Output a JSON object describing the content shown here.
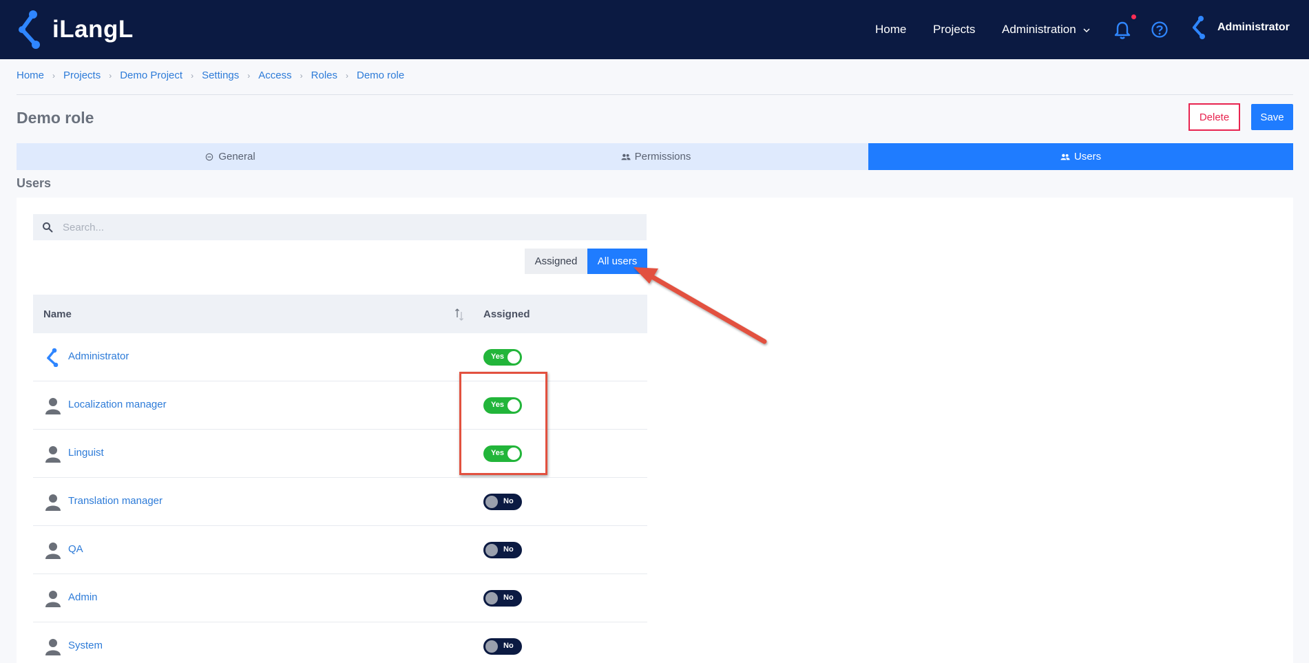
{
  "app": {
    "logo_text": "iLangL",
    "brand_colors": {
      "navbar": "#0b1a42",
      "accent": "#1f7cff",
      "danger": "#e8234f",
      "success": "#22b53a"
    }
  },
  "nav": {
    "home": "Home",
    "projects": "Projects",
    "administration": "Administration",
    "user_name": "Administrator",
    "icons": [
      "bell-icon",
      "help-icon",
      "user-logo-icon",
      "chevron-down-icon"
    ]
  },
  "breadcrumb": [
    "Home",
    "Projects",
    "Demo Project",
    "Settings",
    "Access",
    "Roles",
    "Demo role"
  ],
  "page": {
    "title": "Demo role",
    "delete_label": "Delete",
    "save_label": "Save",
    "section_title": "Users"
  },
  "tabs": [
    {
      "label": "General",
      "icon": "minus-circle-icon",
      "active": false
    },
    {
      "label": "Permissions",
      "icon": "users-icon",
      "active": false
    },
    {
      "label": "Users",
      "icon": "users-icon",
      "active": true
    }
  ],
  "search": {
    "placeholder": "Search...",
    "value": ""
  },
  "filter": {
    "assigned_label": "Assigned",
    "all_label": "All users",
    "selected": "All users"
  },
  "table": {
    "columns": [
      "Name",
      "Assigned"
    ],
    "rows": [
      {
        "name": "Administrator",
        "avatar": "logo-avatar",
        "assigned": true,
        "toggle_label": "Yes"
      },
      {
        "name": "Localization manager",
        "avatar": "person-avatar",
        "assigned": true,
        "toggle_label": "Yes"
      },
      {
        "name": "Linguist",
        "avatar": "person-avatar",
        "assigned": true,
        "toggle_label": "Yes"
      },
      {
        "name": "Translation manager",
        "avatar": "person-avatar",
        "assigned": false,
        "toggle_label": "No"
      },
      {
        "name": "QA",
        "avatar": "person-avatar",
        "assigned": false,
        "toggle_label": "No"
      },
      {
        "name": "Admin",
        "avatar": "person-avatar",
        "assigned": false,
        "toggle_label": "No"
      },
      {
        "name": "System",
        "avatar": "person-avatar",
        "assigned": false,
        "toggle_label": "No"
      }
    ]
  },
  "annotations": {
    "color": "#e2513f"
  }
}
